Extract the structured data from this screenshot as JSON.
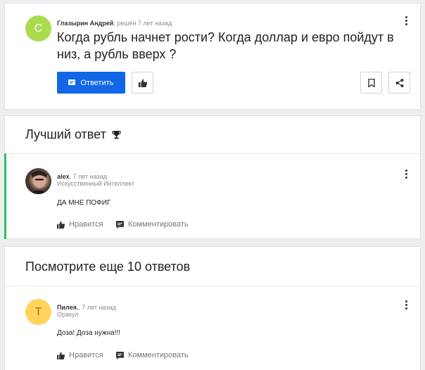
{
  "question": {
    "avatar_letter": "С",
    "avatar_color": "#a9db4f",
    "author": "Глазырин Андрей",
    "meta": ", решён 7 лет назад",
    "text": "Когда рубль начнет рости? Когда доллар и евро пойдут в низ, а рубль вверх ?",
    "answer_button": "Ответить",
    "accent": "#1167e6"
  },
  "best_answer": {
    "title": "Лучший ответ",
    "accent_bar": "#27c16a",
    "author": "alex",
    "meta": ", 7 лет назад",
    "rank": "Искусственный Интеллект",
    "text": "ДА МНЕ ПОФИГ",
    "like_label": "Нравится",
    "comment_label": "Комментировать"
  },
  "more_answers": {
    "title": "Посмотрите еще 10 ответов",
    "answers": [
      {
        "avatar_letter": "Т",
        "avatar_color": "#fcd55a",
        "avatar_text_color": "#c0582a",
        "author": "Пилея.",
        "meta": ", 7 лет назад",
        "rank": "Оракул",
        "text": "Доза! Доза нужна!!!",
        "like_label": "Нравится",
        "comment_label": "Комментировать"
      }
    ]
  }
}
